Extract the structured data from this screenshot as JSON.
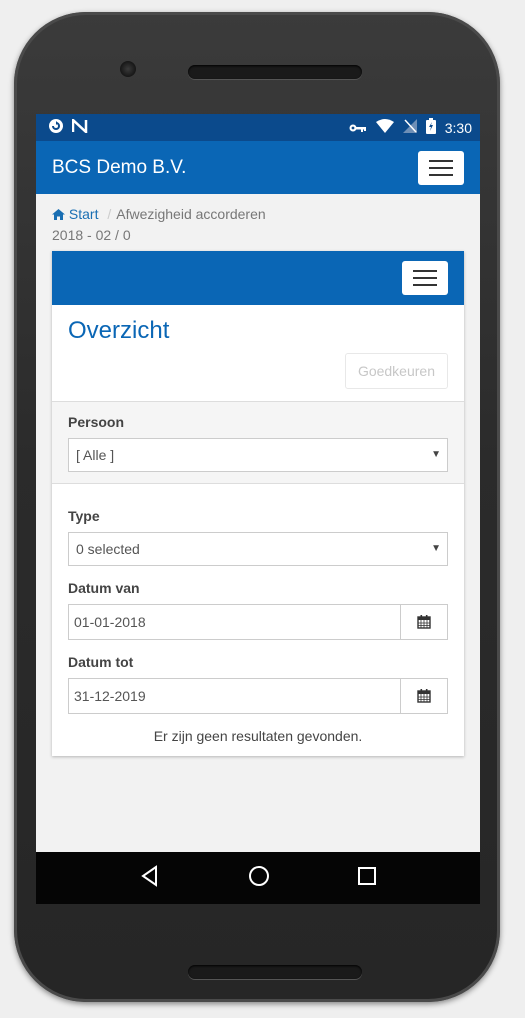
{
  "status_bar": {
    "time": "3:30",
    "icons": [
      "sync-icon",
      "n-icon",
      "key-icon",
      "wifi-icon",
      "no-signal-icon",
      "battery-charging-icon"
    ]
  },
  "app": {
    "brand": "BCS Demo B.V."
  },
  "breadcrumb": {
    "home": "Start",
    "separator": "/",
    "current": "Afwezigheid accorderen"
  },
  "period": "2018 - 02 / 0",
  "panel": {
    "title": "Overzicht",
    "approve_button": "Goedkeuren"
  },
  "filters": {
    "persoon_label": "Persoon",
    "persoon_value": "[ Alle ]",
    "type_label": "Type",
    "type_value": "0 selected",
    "datum_van_label": "Datum van",
    "datum_van_value": "01-01-2018",
    "datum_tot_label": "Datum tot",
    "datum_tot_value": "31-12-2019"
  },
  "results": {
    "empty_message": "Er zijn geen resultaten gevonden."
  },
  "colors": {
    "primary": "#0a66b5",
    "status_bar": "#0b4a8c",
    "link": "#1a6fb3"
  }
}
